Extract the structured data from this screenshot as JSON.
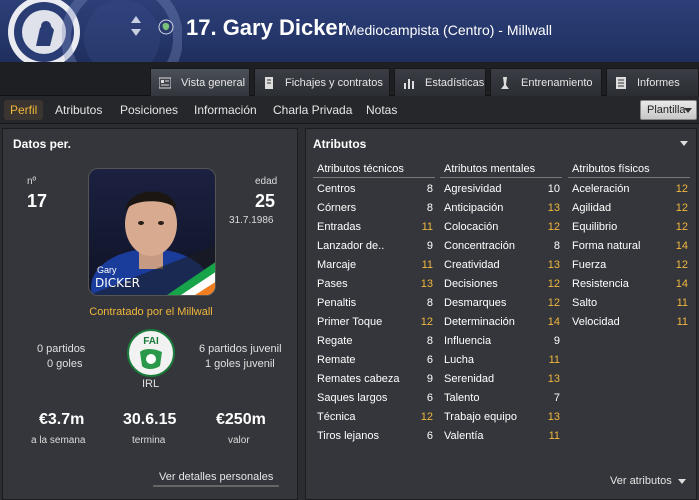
{
  "header": {
    "title": "17. Gary Dicker",
    "subtitle": "Mediocampista (Centro) - Millwall",
    "club_crest_icon": "millwall-crest-icon",
    "nationality_flag_icon": "ireland-flag-icon"
  },
  "tabs": [
    {
      "label": "Vista general",
      "icon": "overview-icon",
      "active": true
    },
    {
      "label": "Fichajes y contratos",
      "icon": "contract-icon"
    },
    {
      "label": "Estadísticas",
      "icon": "bar-chart-icon"
    },
    {
      "label": "Entrenamiento",
      "icon": "training-icon"
    },
    {
      "label": "Informes",
      "icon": "report-icon"
    }
  ],
  "subnav": {
    "items": [
      "Perfil",
      "Atributos",
      "Posiciones",
      "Información",
      "Charla Privada",
      "Notas"
    ],
    "dropdown": "Plantilla"
  },
  "personal": {
    "section_title": "Datos per.",
    "number_label": "nº",
    "number": "17",
    "age_label": "edad",
    "age": "25",
    "dob": "31.7.1986",
    "photo_first_name": "Gary",
    "photo_last_name": "DICKER",
    "contract_text": "Contratado por el Millwall",
    "matches": "0 partidos",
    "goals": "0 goles",
    "youth_matches": "6 partidos juvenil",
    "youth_goals": "1 goles juvenil",
    "nation": "IRL",
    "federation_logo_text": "FAI",
    "wage": "€3.7m",
    "wage_label": "a la semana",
    "contract_end": "30.6.15",
    "contract_end_label": "termina",
    "value": "€250m",
    "value_label": "valor",
    "details_button": "Ver detalles personales"
  },
  "attributes": {
    "section_title": "Atributos",
    "view_button": "Ver atributos",
    "highlight_color": "#f0b73d",
    "columns": [
      {
        "title": "Atributos técnicos",
        "rows": [
          {
            "name": "Centros",
            "value": "8",
            "hi": false
          },
          {
            "name": "Córners",
            "value": "8",
            "hi": false
          },
          {
            "name": "Entradas",
            "value": "11",
            "hi": true
          },
          {
            "name": "Lanzador de..",
            "value": "9",
            "hi": false
          },
          {
            "name": "Marcaje",
            "value": "11",
            "hi": true
          },
          {
            "name": "Pases",
            "value": "13",
            "hi": true
          },
          {
            "name": "Penaltis",
            "value": "8",
            "hi": false
          },
          {
            "name": "Primer Toque",
            "value": "12",
            "hi": true
          },
          {
            "name": "Regate",
            "value": "8",
            "hi": false
          },
          {
            "name": "Remate",
            "value": "6",
            "hi": false
          },
          {
            "name": "Remates cabeza",
            "value": "9",
            "hi": false
          },
          {
            "name": "Saques largos",
            "value": "6",
            "hi": false
          },
          {
            "name": "Técnica",
            "value": "12",
            "hi": true
          },
          {
            "name": "Tiros lejanos",
            "value": "6",
            "hi": false
          }
        ]
      },
      {
        "title": "Atributos mentales",
        "rows": [
          {
            "name": "Agresividad",
            "value": "10",
            "hi": false
          },
          {
            "name": "Anticipación",
            "value": "13",
            "hi": true
          },
          {
            "name": "Colocación",
            "value": "12",
            "hi": true
          },
          {
            "name": "Concentración",
            "value": "8",
            "hi": false
          },
          {
            "name": "Creatividad",
            "value": "13",
            "hi": true
          },
          {
            "name": "Decisiones",
            "value": "12",
            "hi": true
          },
          {
            "name": "Desmarques",
            "value": "12",
            "hi": true
          },
          {
            "name": "Determinación",
            "value": "14",
            "hi": true
          },
          {
            "name": "Influencia",
            "value": "9",
            "hi": false
          },
          {
            "name": "Lucha",
            "value": "11",
            "hi": true
          },
          {
            "name": "Serenidad",
            "value": "13",
            "hi": true
          },
          {
            "name": "Talento",
            "value": "7",
            "hi": false
          },
          {
            "name": "Trabajo equipo",
            "value": "13",
            "hi": true
          },
          {
            "name": "Valentía",
            "value": "11",
            "hi": true
          }
        ]
      },
      {
        "title": "Atributos físicos",
        "rows": [
          {
            "name": "Aceleración",
            "value": "12",
            "hi": true
          },
          {
            "name": "Agilidad",
            "value": "12",
            "hi": true
          },
          {
            "name": "Equilibrio",
            "value": "12",
            "hi": true
          },
          {
            "name": "Forma natural",
            "value": "14",
            "hi": true
          },
          {
            "name": "Fuerza",
            "value": "12",
            "hi": true
          },
          {
            "name": "Resistencia",
            "value": "14",
            "hi": true
          },
          {
            "name": "Salto",
            "value": "11",
            "hi": true
          },
          {
            "name": "Velocidad",
            "value": "11",
            "hi": true
          }
        ]
      }
    ]
  }
}
